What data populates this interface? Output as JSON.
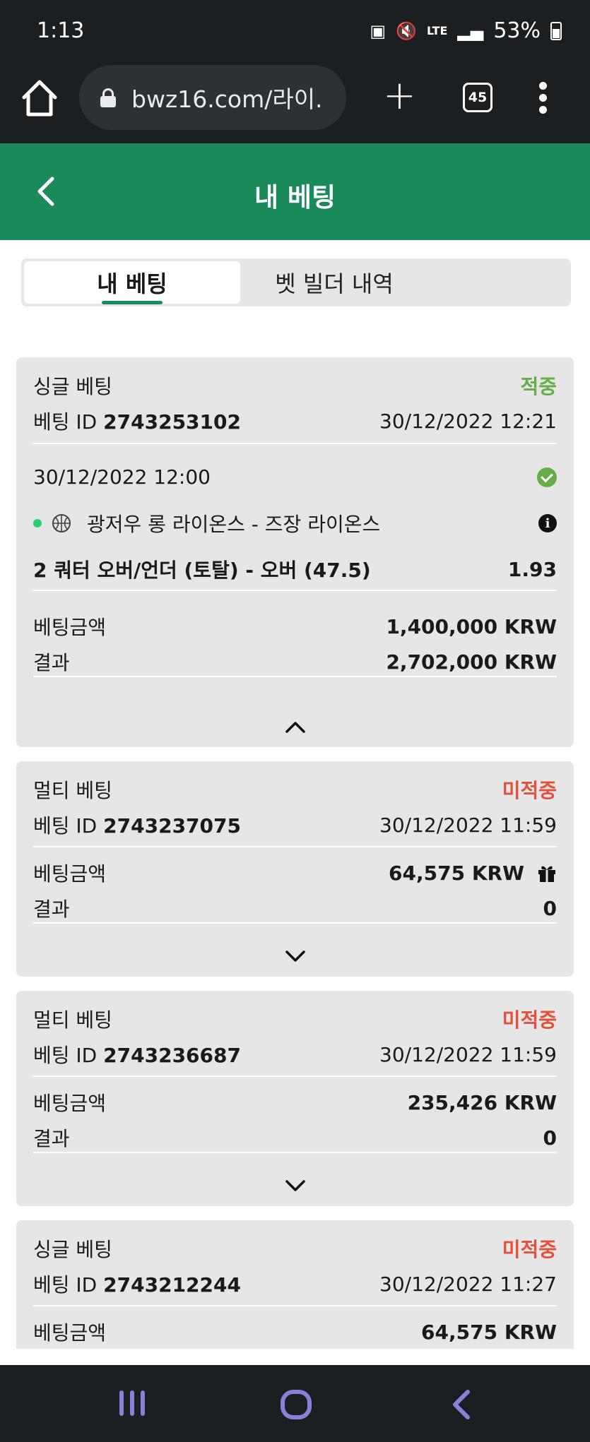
{
  "status_bar": {
    "time": "1:13",
    "lte_label": "LTE",
    "battery": "53%"
  },
  "browser": {
    "url": "bwz16.com/라이.",
    "tab_count": "45"
  },
  "header": {
    "title": "내 베팅"
  },
  "tabs": [
    {
      "label": "내 베팅",
      "active": true
    },
    {
      "label": "벳 빌더 내역",
      "active": false
    }
  ],
  "labels": {
    "bet_id_prefix": "베팅 ID",
    "stake": "베팅금액",
    "result": "결과"
  },
  "bets": [
    {
      "type": "싱글 베팅",
      "status": "적중",
      "bet_id": "2743253102",
      "placed_at": "30/12/2022 12:21",
      "expanded": true,
      "selection": {
        "event_time": "30/12/2022 12:00",
        "match": "광저우 롱 라이온스 - 즈장 라이온스",
        "market": "2 쿼터 오버/언더 (토탈) - 오버 (47.5)",
        "odds": "1.93"
      },
      "stake": "1,400,000 KRW",
      "result": "2,702,000 KRW"
    },
    {
      "type": "멀티 베팅",
      "status": "미적중",
      "bet_id": "2743237075",
      "placed_at": "30/12/2022 11:59",
      "expanded": false,
      "stake": "64,575 KRW",
      "result": "0"
    },
    {
      "type": "멀티 베팅",
      "status": "미적중",
      "bet_id": "2743236687",
      "placed_at": "30/12/2022 11:59",
      "expanded": false,
      "stake": "235,426 KRW",
      "result": "0"
    },
    {
      "type": "싱글 베팅",
      "status": "미적중",
      "bet_id": "2743212244",
      "placed_at": "30/12/2022 11:27",
      "stake": "64,575 KRW"
    }
  ],
  "colors": {
    "brand_green": "#1b8a5a",
    "win": "#66ad47",
    "lose": "#e2513c",
    "card_bg": "#e6e6e6",
    "system_bar": "#1c1f22",
    "nav_icon": "#8a80d8"
  }
}
